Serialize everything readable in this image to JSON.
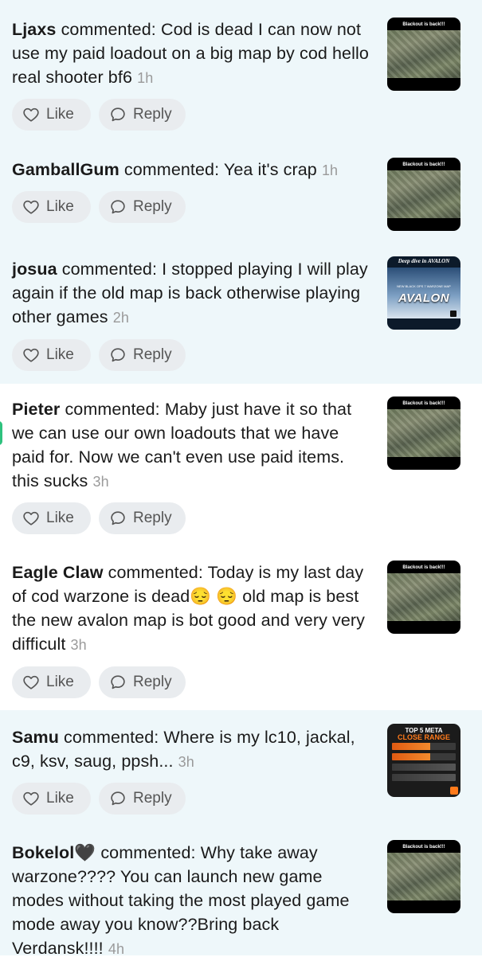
{
  "like_label": "Like",
  "reply_label": "Reply",
  "verb": "commented:",
  "thumb_captions": {
    "blackout": "Blackout is back!!!",
    "deep_dive": "Deep dive in AVALON",
    "avalon_sub": "NEW BLACK OPS 7 WARZONE MAP",
    "avalon_title": "AVALON",
    "meta_title": "TOP 5 META",
    "meta_sub": "CLOSE RANGE"
  },
  "comments": [
    {
      "user": "Ljaxs",
      "text": "Cod is dead I can now not use my paid loadout on a big map by cod hello real shooter bf6",
      "time": "1h",
      "thumb": "blackout"
    },
    {
      "user": "GamballGum",
      "text": "Yea it's crap",
      "time": "1h",
      "thumb": "blackout"
    },
    {
      "user": "josua",
      "text": "I stopped playing I will play again if the old map is back otherwise playing other games",
      "time": "2h",
      "thumb": "avalon"
    },
    {
      "user": "Pieter",
      "text": "Maby just have it so that we can use our own loadouts that we have paid for. Now we can't even use paid items. this sucks",
      "time": "3h",
      "thumb": "blackout"
    },
    {
      "user": "Eagle Claw",
      "text": "Today is my last day of cod warzone is dead😔 😔 old map is best the new avalon map is bot good and very very difficult",
      "time": "3h",
      "thumb": "blackout"
    },
    {
      "user": "Samu",
      "text": "Where is my lc10, jackal, c9, ksv, saug, ppsh...",
      "time": "3h",
      "thumb": "meta"
    },
    {
      "user": "Bokelol🖤",
      "text": "Why take away warzone???? You can launch new game modes without taking the most played game mode away you know??Bring back Verdansk!!!!",
      "time": "4h",
      "thumb": "blackout"
    }
  ],
  "colors": {
    "tint": "#eef7fa",
    "pill": "#e9ecef",
    "time": "#9a9a9a",
    "accent_green": "#2ec27e"
  }
}
